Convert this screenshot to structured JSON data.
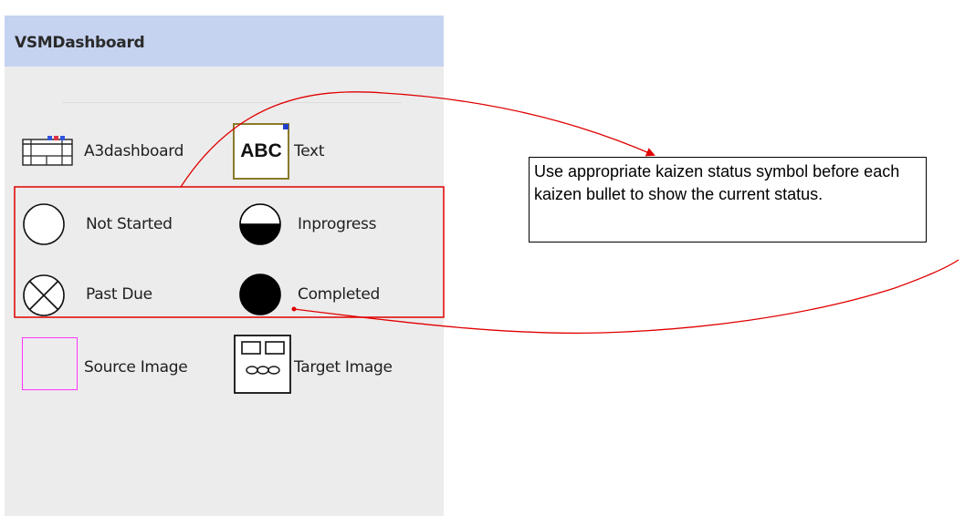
{
  "panel": {
    "title": "VSMDashboard"
  },
  "items": {
    "a3dashboard": {
      "label": "A3dashboard",
      "icon": "a3-dashboard-icon"
    },
    "text": {
      "label": "Text",
      "icon_text": "ABC",
      "icon": "text-abc-icon"
    },
    "not_started": {
      "label": "Not Started",
      "icon": "empty-circle-icon"
    },
    "inprogress": {
      "label": "Inprogress",
      "icon": "half-filled-circle-icon"
    },
    "past_due": {
      "label": "Past Due",
      "icon": "crossed-circle-icon"
    },
    "completed": {
      "label": "Completed",
      "icon": "filled-circle-icon"
    },
    "source_image": {
      "label": "Source Image",
      "icon": "magenta-square-icon"
    },
    "target_image": {
      "label": "Target Image",
      "icon": "target-image-icon"
    }
  },
  "annotation": {
    "callout_text": "Use appropriate kaizen status symbol before each kaizen bullet to show the current status.",
    "highlight_color": "#e00000",
    "arrow_color": "#e00000"
  },
  "colors": {
    "header_bg": "#c5d3f0",
    "panel_bg": "#ececec",
    "source_image_border": "#ff33ff",
    "text_icon_border": "#8a7a2a",
    "text_icon_corner": "#1f3fcf"
  }
}
